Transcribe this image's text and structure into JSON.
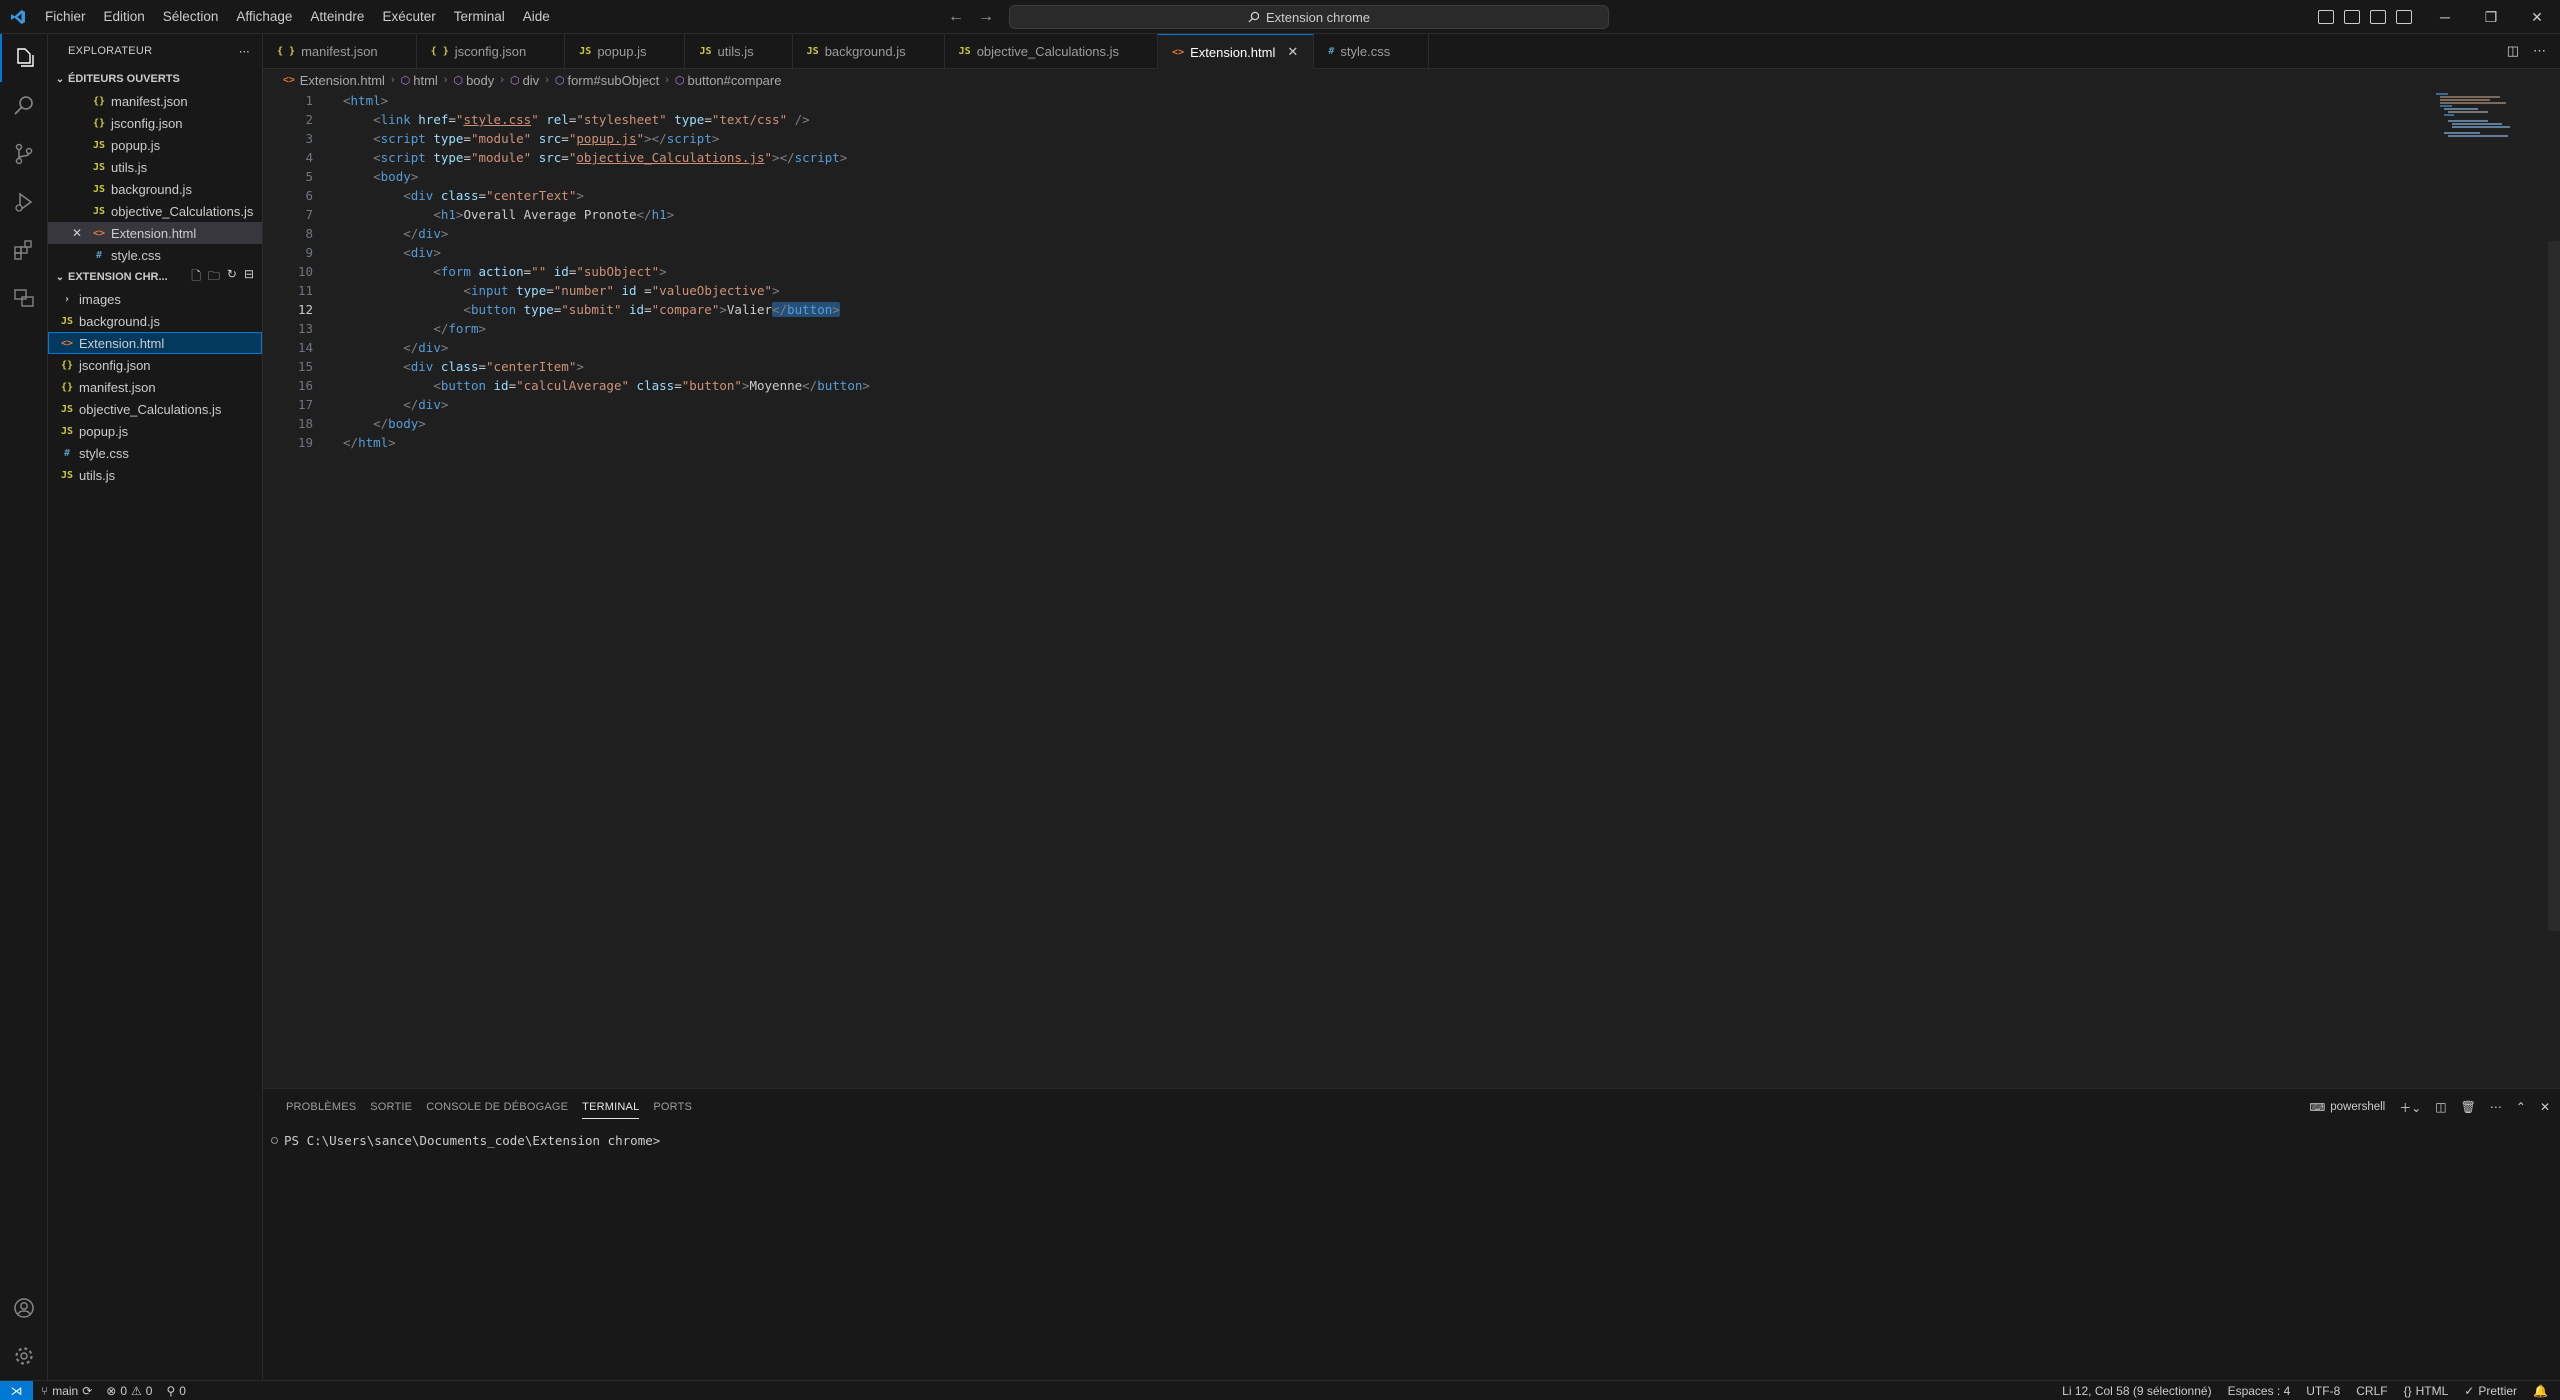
{
  "window": {
    "search_text": "Extension chrome",
    "menu": [
      "Fichier",
      "Edition",
      "Sélection",
      "Affichage",
      "Atteindre",
      "Exécuter",
      "Terminal",
      "Aide"
    ]
  },
  "sidebar": {
    "title": "EXPLORATEUR",
    "open_editors_title": "ÉDITEURS OUVERTS",
    "open_editors": [
      {
        "name": "manifest.json",
        "type": "json"
      },
      {
        "name": "jsconfig.json",
        "type": "json"
      },
      {
        "name": "popup.js",
        "type": "js"
      },
      {
        "name": "utils.js",
        "type": "js"
      },
      {
        "name": "background.js",
        "type": "js"
      },
      {
        "name": "objective_Calculations.js",
        "type": "js"
      },
      {
        "name": "Extension.html",
        "type": "html"
      },
      {
        "name": "style.css",
        "type": "css"
      }
    ],
    "folder_title": "EXTENSION CHR...",
    "tree": [
      {
        "name": "images",
        "type": "folder"
      },
      {
        "name": "background.js",
        "type": "js"
      },
      {
        "name": "Extension.html",
        "type": "html"
      },
      {
        "name": "jsconfig.json",
        "type": "json"
      },
      {
        "name": "manifest.json",
        "type": "json"
      },
      {
        "name": "objective_Calculations.js",
        "type": "js"
      },
      {
        "name": "popup.js",
        "type": "js"
      },
      {
        "name": "style.css",
        "type": "css"
      },
      {
        "name": "utils.js",
        "type": "js"
      }
    ]
  },
  "tabs": [
    {
      "label": "manifest.json",
      "icon": "{ }"
    },
    {
      "label": "jsconfig.json",
      "icon": "{ }"
    },
    {
      "label": "popup.js",
      "icon": "JS"
    },
    {
      "label": "utils.js",
      "icon": "JS"
    },
    {
      "label": "background.js",
      "icon": "JS"
    },
    {
      "label": "objective_Calculations.js",
      "icon": "JS"
    },
    {
      "label": "Extension.html",
      "icon": "<>"
    },
    {
      "label": "style.css",
      "icon": "#"
    }
  ],
  "breadcrumb": [
    "Extension.html",
    "html",
    "body",
    "div",
    "form#subObject",
    "button#compare"
  ],
  "editor": {
    "line_numbers": [
      "1",
      "2",
      "3",
      "4",
      "5",
      "6",
      "7",
      "8",
      "9",
      "10",
      "11",
      "12",
      "13",
      "14",
      "15",
      "16",
      "17",
      "18",
      "19"
    ],
    "current_line": "12"
  },
  "panel": {
    "tabs": [
      "PROBLÈMES",
      "SORTIE",
      "CONSOLE DE DÉBOGAGE",
      "TERMINAL",
      "PORTS"
    ],
    "shell": "powershell",
    "prompt": "PS C:\\Users\\sance\\Documents_code\\Extension chrome>"
  },
  "status": {
    "branch": "main",
    "errors": "0",
    "warnings": "0",
    "ports": "0",
    "cursor": "Li 12, Col 58 (9 sélectionné)",
    "spaces": "Espaces : 4",
    "encoding": "UTF-8",
    "eol": "CRLF",
    "language": "HTML",
    "formatter": "Prettier"
  }
}
